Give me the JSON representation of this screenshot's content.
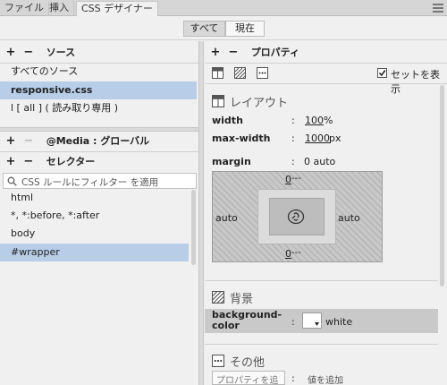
{
  "tabs": [
    "ファイル",
    "挿入",
    "CSS デザイナー"
  ],
  "toggle": {
    "all": "すべて",
    "current": "現在"
  },
  "sources": {
    "add": "+",
    "remove": "−",
    "title": "ソース",
    "items": [
      "すべてのソース",
      "responsive.css",
      "l [ all ] ( 読み取り専用 )"
    ]
  },
  "media": {
    "add": "+",
    "remove": "−",
    "title": "@Media :  グローバル"
  },
  "selectors": {
    "add": "+",
    "remove": "−",
    "title": "セレクター",
    "filter_placeholder": "CSS ルールにフィルター を適用",
    "items": [
      "html",
      "*, *:before, *:after",
      "body",
      "#wrapper"
    ]
  },
  "properties": {
    "add": "+",
    "remove": "−",
    "title": "プロパティ",
    "show_set_label": "セットを表示",
    "show_set_checked": true,
    "layout_title": "レイアウト",
    "width_label": "width",
    "width_value": "100",
    "width_unit": "%",
    "maxwidth_label": "max-width",
    "maxwidth_value": "1000",
    "maxwidth_unit": "px",
    "margin_label": "margin",
    "margin_value": "0 auto",
    "box": {
      "top": "0",
      "top_rest": " ---",
      "left": "auto",
      "right": "auto",
      "bottom": "0",
      "bottom_rest": " ---"
    },
    "bg_title": "背景",
    "bgcolor_label_1": "background-",
    "bgcolor_label_2": "color",
    "bgcolor_value": "white",
    "other_title": "その他",
    "add_property_placeholder": "プロパティを追加",
    "add_value_text": "値を追加",
    "colon": ":"
  },
  "colors": {
    "selection": "#b7cde8",
    "panel": "#f0f0f0",
    "property_highlight": "#c9c9c9"
  }
}
